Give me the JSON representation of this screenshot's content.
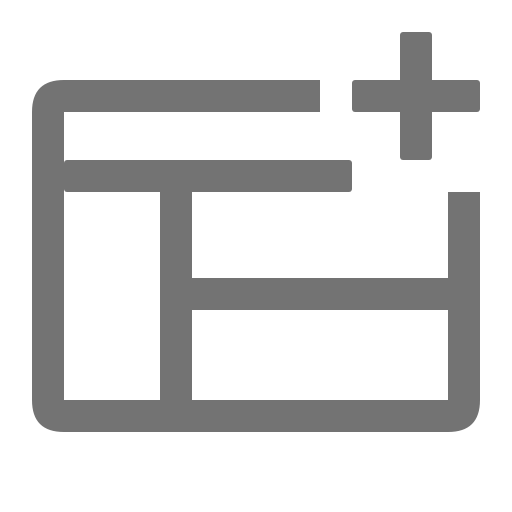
{
  "icon": {
    "name": "add-layout-icon",
    "color": "#737373",
    "background": "#ffffff"
  }
}
